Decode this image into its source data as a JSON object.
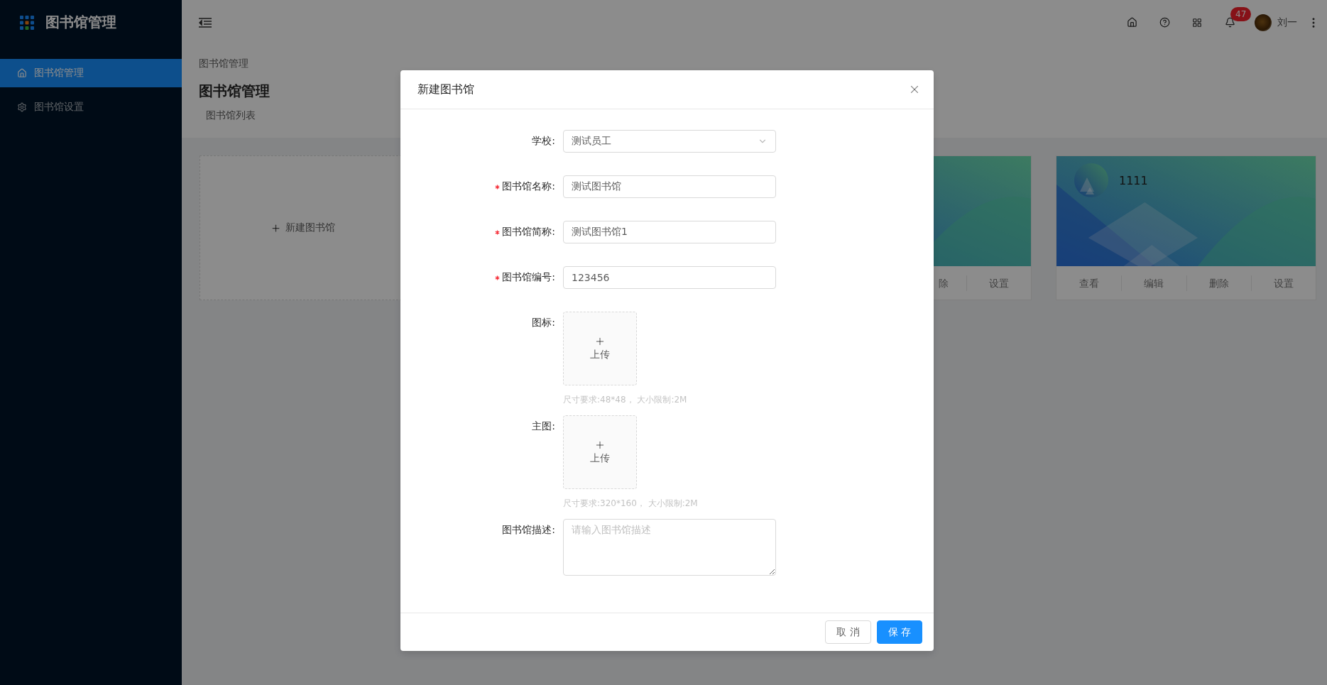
{
  "sidebar": {
    "title": "图书馆管理",
    "items": [
      {
        "label": "图书馆管理",
        "selected": true
      },
      {
        "label": "图书馆设置",
        "selected": false
      }
    ]
  },
  "header": {
    "notifications": "47",
    "user": "刘一"
  },
  "page": {
    "breadcrumb": "图书馆管理",
    "title": "图书馆管理",
    "tab": "图书馆列表"
  },
  "new_card": {
    "label": "新建图书馆"
  },
  "cards": [
    {
      "actions": [
        "除",
        "设置"
      ]
    },
    {
      "name": "1111",
      "actions": [
        "查看",
        "编辑",
        "删除",
        "设置"
      ]
    }
  ],
  "dialog": {
    "title": "新建图书馆",
    "fields": [
      {
        "kind": "select",
        "label": "学校:",
        "required": false,
        "value": "测试员工"
      },
      {
        "kind": "input",
        "label": "图书馆名称:",
        "required": true,
        "value": "测试图书馆"
      },
      {
        "kind": "input",
        "label": "图书馆简称:",
        "required": true,
        "value": "测试图书馆1"
      },
      {
        "kind": "input",
        "label": "图书馆编号:",
        "required": true,
        "value": "123456"
      },
      {
        "kind": "upload",
        "label": "图标:",
        "required": false,
        "button": "上传",
        "hint": "尺寸要求:48*48， 大小限制:2M"
      },
      {
        "kind": "upload",
        "label": "主图:",
        "required": false,
        "button": "上传",
        "hint": "尺寸要求:320*160， 大小限制:2M"
      },
      {
        "kind": "textarea",
        "label": "图书馆描述:",
        "required": false,
        "placeholder": "请输入图书馆描述"
      }
    ],
    "buttons": [
      {
        "label": "取 消",
        "kind": "default"
      },
      {
        "label": "保 存",
        "kind": "primary"
      }
    ]
  }
}
